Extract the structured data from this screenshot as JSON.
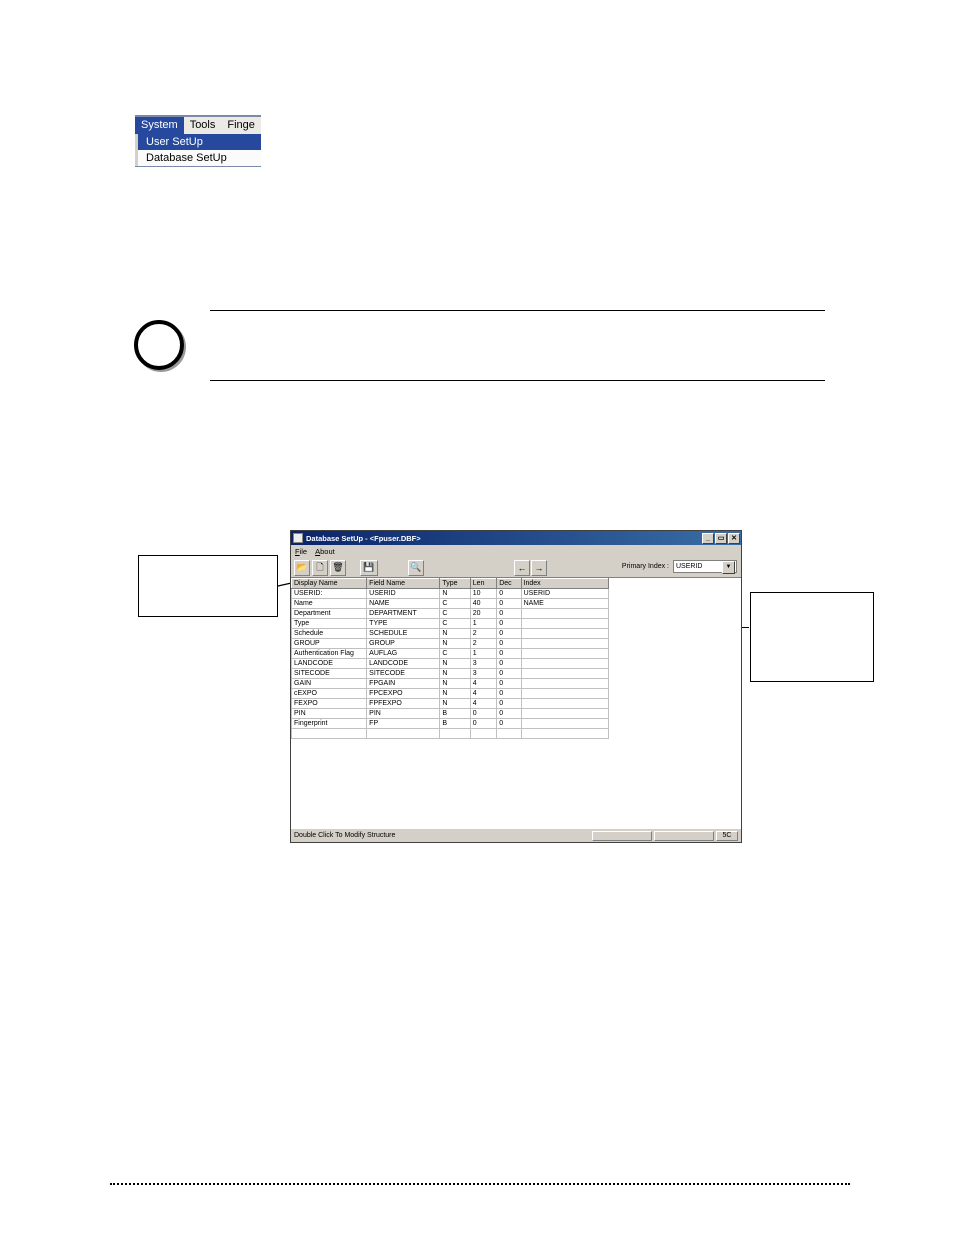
{
  "small_menu": {
    "items": [
      "System",
      "Tools",
      "Finge"
    ],
    "selected_index": 0,
    "dropdown": [
      "User SetUp",
      "Database SetUp"
    ],
    "dropdown_highlight_index": 0
  },
  "app": {
    "title": "Database SetUp - <Fpuser.DBF>",
    "menubar": {
      "file": "File",
      "about": "About"
    },
    "primary_index_label": "Primary Index :",
    "primary_index_value": "USERID",
    "status_left": "Double Click To Modify Structure",
    "status_right": "5C",
    "columns": [
      "Display Name",
      "Field Name",
      "Type",
      "Len",
      "Dec",
      "Index"
    ],
    "rows": [
      {
        "display": "USERID:",
        "field": "USERID",
        "type": "N",
        "len": "10",
        "dec": "0",
        "index": "USERID"
      },
      {
        "display": "Name",
        "field": "NAME",
        "type": "C",
        "len": "40",
        "dec": "0",
        "index": "NAME"
      },
      {
        "display": "Department",
        "field": "DEPARTMENT",
        "type": "C",
        "len": "20",
        "dec": "0",
        "index": ""
      },
      {
        "display": "Type",
        "field": "TYPE",
        "type": "C",
        "len": "1",
        "dec": "0",
        "index": ""
      },
      {
        "display": "Schedule",
        "field": "SCHEDULE",
        "type": "N",
        "len": "2",
        "dec": "0",
        "index": ""
      },
      {
        "display": "GROUP",
        "field": "GROUP",
        "type": "N",
        "len": "2",
        "dec": "0",
        "index": ""
      },
      {
        "display": "Authentication Flag",
        "field": "AUFLAG",
        "type": "C",
        "len": "1",
        "dec": "0",
        "index": ""
      },
      {
        "display": "LANDCODE",
        "field": "LANDCODE",
        "type": "N",
        "len": "3",
        "dec": "0",
        "index": ""
      },
      {
        "display": "SITECODE",
        "field": "SITECODE",
        "type": "N",
        "len": "3",
        "dec": "0",
        "index": ""
      },
      {
        "display": "GAIN",
        "field": "FPGAIN",
        "type": "N",
        "len": "4",
        "dec": "0",
        "index": ""
      },
      {
        "display": "cEXPO",
        "field": "FPCEXPO",
        "type": "N",
        "len": "4",
        "dec": "0",
        "index": ""
      },
      {
        "display": "FEXPO",
        "field": "FPFEXPO",
        "type": "N",
        "len": "4",
        "dec": "0",
        "index": ""
      },
      {
        "display": "PIN",
        "field": "PIN",
        "type": "B",
        "len": "0",
        "dec": "0",
        "index": ""
      },
      {
        "display": "Fingerprint",
        "field": "FP",
        "type": "B",
        "len": "0",
        "dec": "0",
        "index": ""
      }
    ]
  },
  "icons": {
    "open": "📂",
    "new": "🗋",
    "delete": "🗑",
    "save": "💾",
    "zoom": "🔍",
    "back": "←",
    "fwd": "→",
    "min": "_",
    "max": "▭",
    "close": "✕"
  }
}
